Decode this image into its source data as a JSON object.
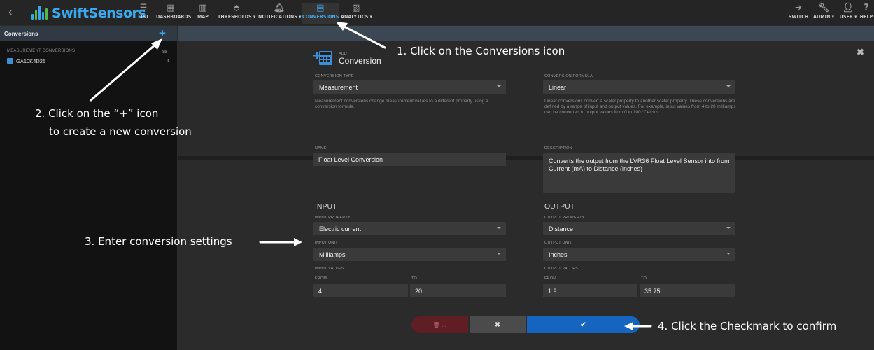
{
  "nav": {
    "brand": "SwiftSensors",
    "items": [
      {
        "label": "LIST"
      },
      {
        "label": "DASHBOARDS"
      },
      {
        "label": "MAP"
      },
      {
        "label": "THRESHOLDS ▾"
      },
      {
        "label": "NOTIFICATIONS ▾"
      },
      {
        "label": "CONVERSIONS"
      },
      {
        "label": "ANALYTICS ▾"
      }
    ],
    "right": [
      {
        "label": "SWITCH"
      },
      {
        "label": "ADMIN ▾"
      },
      {
        "label": "USER ▾"
      },
      {
        "label": "HELP"
      }
    ]
  },
  "sidebar": {
    "title": "Conversions",
    "section": "MEASUREMENT CONVERSIONS",
    "items": [
      {
        "label": "GA10K4D25",
        "count": "1"
      }
    ]
  },
  "form": {
    "title_small": "ADD",
    "title": "Conversion",
    "type_label": "CONVERSION TYPE",
    "type_value": "Measurement",
    "type_help": "Measurement conversions change measurement values to a different property using a conversion formula.",
    "formula_label": "CONVERSION FORMULA",
    "formula_value": "Linear",
    "formula_help": "Linear conversions convert a scalar property to another scalar property. These conversions are defined by a range of input and output values. For example, input values from 4 to 20 milliamps can be converted to output values from 0 to 100 °Celcius.",
    "name_label": "NAME",
    "name_value": "Float Level Conversion",
    "desc_label": "DESCRIPTION",
    "desc_value": "Converts the output from the LVR36 Float Level Sensor into from Current (mA) to Distance (inches)",
    "input_title": "INPUT",
    "input_property_label": "INPUT PROPERTY",
    "input_property": "Electric current",
    "input_unit_label": "INPUT UNIT",
    "input_unit": "Milliamps",
    "input_values_label": "INPUT VALUES",
    "output_title": "OUTPUT",
    "output_property_label": "OUTPUT PROPERTY",
    "output_property": "Distance",
    "output_unit_label": "OUTPUT UNIT",
    "output_unit": "Inches",
    "output_values_label": "OUTPUT VALUES",
    "from_label": "FROM",
    "to_label": "TO",
    "input_from": "4",
    "input_to": "20",
    "output_from": "1.9",
    "output_to": "35.75",
    "delete_label": "…",
    "cancel_label": "✖",
    "confirm_label": "✔"
  },
  "annotations": {
    "step1": "1.  Click on the Conversions icon",
    "step2a": "2. Click on the “+” icon",
    "step2b": "to create a new conversion",
    "step3": "3. Enter conversion settings",
    "step4": "4. Click the Checkmark to confirm"
  },
  "colors": {
    "accent": "#3aa9ee",
    "confirm": "#1565c0",
    "delete": "#5e1e23"
  }
}
